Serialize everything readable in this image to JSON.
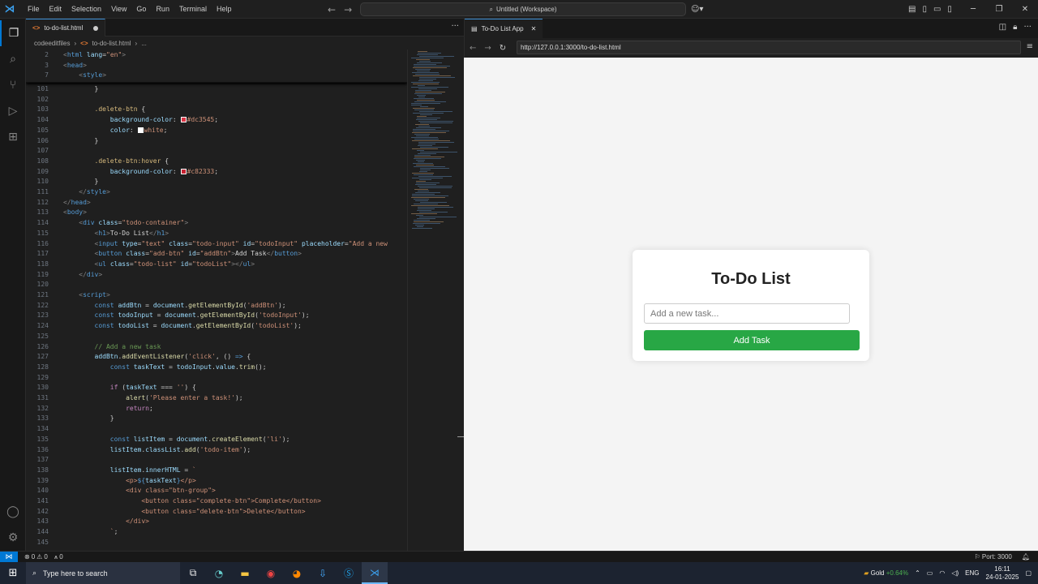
{
  "titlebar": {
    "menu": [
      "File",
      "Edit",
      "Selection",
      "View",
      "Go",
      "Run",
      "Terminal",
      "Help"
    ],
    "command_center": "Untitled (Workspace)"
  },
  "editor": {
    "tab_label": "to-do-list.html",
    "breadcrumb": [
      "codeeditfiles",
      "to-do-list.html",
      "..."
    ],
    "sticky_lines": [
      {
        "n": "2",
        "html": "<span class='p'>&lt;</span><span class='t'>html</span> <span class='at'>lang</span>=<span class='s'>\"en\"</span><span class='p'>&gt;</span>"
      },
      {
        "n": "3",
        "html": "<span class='p'>&lt;</span><span class='t'>head</span><span class='p'>&gt;</span>"
      },
      {
        "n": "7",
        "html": "    <span class='p'>&lt;</span><span class='t'>style</span><span class='p'>&gt;</span>"
      }
    ],
    "lines": [
      {
        "n": "101",
        "html": "        <span class='txt'>}</span>"
      },
      {
        "n": "102",
        "html": ""
      },
      {
        "n": "103",
        "html": "        <span class='sel'>.delete-btn</span> <span class='txt'>{</span>"
      },
      {
        "n": "104",
        "html": "            <span class='pr'>background-color</span>: <span class='sw' style='background:#dc3545'></span><span class='s'>#dc3545</span>;"
      },
      {
        "n": "105",
        "html": "            <span class='pr'>color</span>: <span class='sw' style='background:#ffffff'></span><span class='s'>white</span>;"
      },
      {
        "n": "106",
        "html": "        <span class='txt'>}</span>"
      },
      {
        "n": "107",
        "html": ""
      },
      {
        "n": "108",
        "html": "        <span class='sel'>.delete-btn:hover</span> <span class='txt'>{</span>"
      },
      {
        "n": "109",
        "html": "            <span class='pr'>background-color</span>: <span class='sw' style='background:#c82333'></span><span class='s'>#c82333</span>;"
      },
      {
        "n": "110",
        "html": "        <span class='txt'>}</span>"
      },
      {
        "n": "111",
        "html": "    <span class='p'>&lt;/</span><span class='t'>style</span><span class='p'>&gt;</span>"
      },
      {
        "n": "112",
        "html": "<span class='p'>&lt;/</span><span class='t'>head</span><span class='p'>&gt;</span>"
      },
      {
        "n": "113",
        "html": "<span class='p'>&lt;</span><span class='t'>body</span><span class='p'>&gt;</span>"
      },
      {
        "n": "114",
        "html": "    <span class='p'>&lt;</span><span class='t'>div</span> <span class='at'>class</span>=<span class='s'>\"todo-container\"</span><span class='p'>&gt;</span>"
      },
      {
        "n": "115",
        "html": "        <span class='p'>&lt;</span><span class='t'>h1</span><span class='p'>&gt;</span><span class='txt'>To-Do List</span><span class='p'>&lt;/</span><span class='t'>h1</span><span class='p'>&gt;</span>"
      },
      {
        "n": "116",
        "html": "        <span class='p'>&lt;</span><span class='t'>input</span> <span class='at'>type</span>=<span class='s'>\"text\"</span> <span class='at'>class</span>=<span class='s'>\"todo-input\"</span> <span class='at'>id</span>=<span class='s'>\"todoInput\"</span> <span class='at'>placeholder</span>=<span class='s'>\"Add a new</span>"
      },
      {
        "n": "117",
        "html": "        <span class='p'>&lt;</span><span class='t'>button</span> <span class='at'>class</span>=<span class='s'>\"add-btn\"</span> <span class='at'>id</span>=<span class='s'>\"addBtn\"</span><span class='p'>&gt;</span><span class='txt'>Add Task</span><span class='p'>&lt;/</span><span class='t'>button</span><span class='p'>&gt;</span>"
      },
      {
        "n": "118",
        "html": "        <span class='p'>&lt;</span><span class='t'>ul</span> <span class='at'>class</span>=<span class='s'>\"todo-list\"</span> <span class='at'>id</span>=<span class='s'>\"todoList\"</span><span class='p'>&gt;&lt;/</span><span class='t'>ul</span><span class='p'>&gt;</span>"
      },
      {
        "n": "119",
        "html": "    <span class='p'>&lt;/</span><span class='t'>div</span><span class='p'>&gt;</span>"
      },
      {
        "n": "120",
        "html": ""
      },
      {
        "n": "121",
        "html": "    <span class='p'>&lt;</span><span class='t'>script</span><span class='p'>&gt;</span>"
      },
      {
        "n": "122",
        "html": "        <span class='kw'>const</span> <span class='v'>addBtn</span> = <span class='v'>document</span>.<span class='f'>getElementById</span>(<span class='s'>'addBtn'</span>);"
      },
      {
        "n": "123",
        "html": "        <span class='kw'>const</span> <span class='v'>todoInput</span> = <span class='v'>document</span>.<span class='f'>getElementById</span>(<span class='s'>'todoInput'</span>);"
      },
      {
        "n": "124",
        "html": "        <span class='kw'>const</span> <span class='v'>todoList</span> = <span class='v'>document</span>.<span class='f'>getElementById</span>(<span class='s'>'todoList'</span>);"
      },
      {
        "n": "125",
        "html": ""
      },
      {
        "n": "126",
        "html": "        <span class='c'>// Add a new task</span>"
      },
      {
        "n": "127",
        "html": "        <span class='v'>addBtn</span>.<span class='f'>addEventListener</span>(<span class='s'>'click'</span>, () <span class='kw'>=&gt;</span> {"
      },
      {
        "n": "128",
        "html": "            <span class='kw'>const</span> <span class='v'>taskText</span> = <span class='v'>todoInput</span>.<span class='v'>value</span>.<span class='f'>trim</span>();"
      },
      {
        "n": "129",
        "html": ""
      },
      {
        "n": "130",
        "html": "            <span class='k'>if</span> (<span class='v'>taskText</span> === <span class='s'>''</span>) {"
      },
      {
        "n": "131",
        "html": "                <span class='f'>alert</span>(<span class='s'>'Please enter a task!'</span>);"
      },
      {
        "n": "132",
        "html": "                <span class='k'>return</span>;"
      },
      {
        "n": "133",
        "html": "            }"
      },
      {
        "n": "134",
        "html": ""
      },
      {
        "n": "135",
        "html": "            <span class='kw'>const</span> <span class='v'>listItem</span> = <span class='v'>document</span>.<span class='f'>createElement</span>(<span class='s'>'li'</span>);"
      },
      {
        "n": "136",
        "html": "            <span class='v'>listItem</span>.<span class='v'>classList</span>.<span class='f'>add</span>(<span class='s'>'todo-item'</span>);"
      },
      {
        "n": "137",
        "html": ""
      },
      {
        "n": "138",
        "html": "            <span class='v'>listItem</span>.<span class='v'>innerHTML</span> = <span class='s'>`</span>"
      },
      {
        "n": "139",
        "html": "                <span class='s'>&lt;p&gt;</span><span class='kw'>${</span><span class='v'>taskText</span><span class='kw'>}</span><span class='s'>&lt;/p&gt;</span>"
      },
      {
        "n": "140",
        "html": "                <span class='s'>&lt;div class=\"btn-group\"&gt;</span>"
      },
      {
        "n": "141",
        "html": "                    <span class='s'>&lt;button class=\"complete-btn\"&gt;Complete&lt;/button&gt;</span>"
      },
      {
        "n": "142",
        "html": "                    <span class='s'>&lt;button class=\"delete-btn\"&gt;Delete&lt;/button&gt;</span>"
      },
      {
        "n": "143",
        "html": "                <span class='s'>&lt;/div&gt;</span>"
      },
      {
        "n": "144",
        "html": "            <span class='s'>`</span>;"
      },
      {
        "n": "145",
        "html": ""
      }
    ]
  },
  "preview": {
    "tab_label": "To-Do List App",
    "url": "http://127.0.0.1:3000/to-do-list.html",
    "app": {
      "title": "To-Do List",
      "input_placeholder": "Add a new task...",
      "button_label": "Add Task",
      "button_color": "#28a745"
    }
  },
  "statusbar": {
    "errors": "0",
    "warnings": "0",
    "ports": "0",
    "port_label": "Port: 3000"
  },
  "taskbar": {
    "search_placeholder": "Type here to search",
    "weather_label": "Gold",
    "weather_change": "+0.64%",
    "lang": "ENG",
    "time": "16:11",
    "date": "24-01-2025"
  }
}
